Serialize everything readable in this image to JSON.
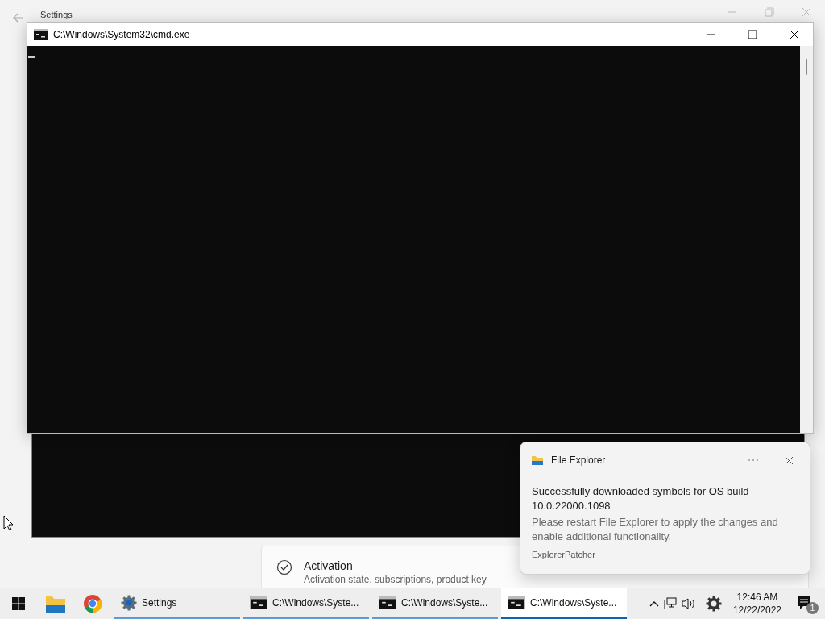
{
  "settings_window": {
    "title": "Settings"
  },
  "activation_card": {
    "title": "Activation",
    "subtitle": "Activation state, subscriptions, product key"
  },
  "console_window": {
    "title": "C:\\Windows\\System32\\cmd.exe"
  },
  "notification": {
    "app": "File Explorer",
    "title": "Successfully downloaded symbols for OS build 10.0.22000.1098",
    "body": "Please restart File Explorer to apply the changes and enable additional functionality.",
    "source": "ExplorerPatcher"
  },
  "taskbar": {
    "apps": [
      {
        "kind": "settings",
        "label": "Settings",
        "active": false
      },
      {
        "kind": "console",
        "label": "C:\\Windows\\Syste...",
        "active": false
      },
      {
        "kind": "console",
        "label": "C:\\Windows\\Syste...",
        "active": false
      },
      {
        "kind": "console",
        "label": "C:\\Windows\\Syste...",
        "active": true
      }
    ],
    "clock": {
      "time": "12:46 AM",
      "date": "12/22/2022"
    },
    "notification_count": "1"
  }
}
